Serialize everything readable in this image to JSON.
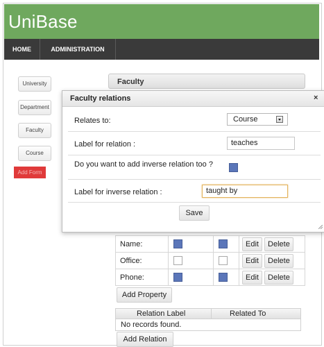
{
  "app": {
    "title": "UniBase"
  },
  "nav": {
    "items": [
      "HOME",
      "ADMINISTRATION"
    ]
  },
  "sidebar": {
    "items": [
      "University",
      "Department",
      "Faculty",
      "Course"
    ],
    "add_label": "Add Form"
  },
  "main": {
    "tab_title": "Faculty",
    "properties": [
      {
        "name": "Name:",
        "col1": true,
        "col2": true
      },
      {
        "name": "Office:",
        "col1": false,
        "col2": false
      },
      {
        "name": "Phone:",
        "col1": true,
        "col2": true
      }
    ],
    "edit_label": "Edit",
    "delete_label": "Delete",
    "add_property_label": "Add Property",
    "relations_table": {
      "headers": [
        "Relation Label",
        "Related To"
      ],
      "empty_text": "No records found."
    },
    "add_relation_label": "Add Relation"
  },
  "dialog": {
    "title": "Faculty relations",
    "close_label": "×",
    "relates_to_label": "Relates to:",
    "relates_to_value": "Course",
    "label_for_relation_label": "Label for relation :",
    "label_for_relation_value": "teaches",
    "inverse_question": "Do you want to add inverse relation too ?",
    "inverse_checked": true,
    "inverse_label_label": "Label for inverse relation :",
    "inverse_label_value": "taught by",
    "save_label": "Save"
  },
  "colors": {
    "header_green": "#6fa85e",
    "nav_dark": "#3a3a3a",
    "add_red": "#e03a3a",
    "checkbox_blue": "#5b76b9",
    "focus_orange": "#e3b35c"
  }
}
